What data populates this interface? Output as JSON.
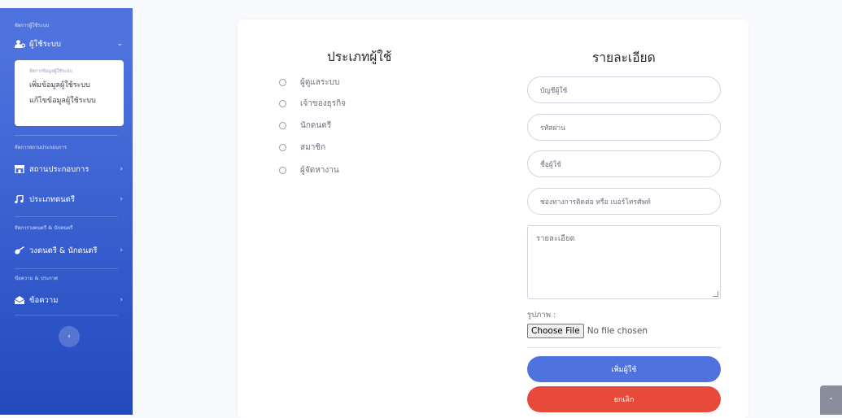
{
  "colors": {
    "primary": "#4e73df",
    "danger": "#e74a3b"
  },
  "sidebar": {
    "heading_users": "จัดการผู้ใช้ระบบ",
    "users_item": {
      "label": "ผู้ใช้ระบบ",
      "icon": "user-cog-icon"
    },
    "submenu": {
      "heading": "จัดการข้อมูลผู้ใช้ระบบ",
      "items": [
        "เพิ่มข้อมูลผู้ใช้ระบบ",
        "แก้ไขข้อมูลผู้ใช้ระบบ"
      ]
    },
    "heading_venues": "จัดการสถานประกอบการ",
    "venue_item": {
      "label": "สถานประกอบการ",
      "icon": "store-icon"
    },
    "music_item": {
      "label": "ประเภทดนตรี",
      "icon": "music-icon"
    },
    "heading_bands": "จัดการวงดนตรี & นักดนตรี",
    "band_item": {
      "label": "วงดนตรี & นักดนตรี",
      "icon": "guitar-icon"
    },
    "heading_messages": "ข้อความ & ประกาศ",
    "message_item": {
      "label": "ข้อความ",
      "icon": "envelope-open-icon"
    }
  },
  "form": {
    "user_type_title": "ประเภทผู้ใช้",
    "details_title": "รายละเอียด",
    "user_types": [
      "ผู้ดูแลระบบ",
      "เจ้าของธุรกิจ",
      "นักดนตรี",
      "สมาชิก",
      "ผู้จัดหางาน"
    ],
    "placeholders": {
      "account": "บัญชีผู้ใช้",
      "password": "รหัสผ่าน",
      "name": "ชื่อผู้ใช้",
      "contact": "ช่องทางการติดต่อ หรือ เบอร์โทรศัพท์",
      "details": "รายละเอียด"
    },
    "image_label": "รูปภาพ :",
    "file_button": "Choose File",
    "file_status": "No file chosen",
    "submit_label": "เพิ่มผู้ใช้",
    "cancel_label": "ยกเลิก"
  }
}
